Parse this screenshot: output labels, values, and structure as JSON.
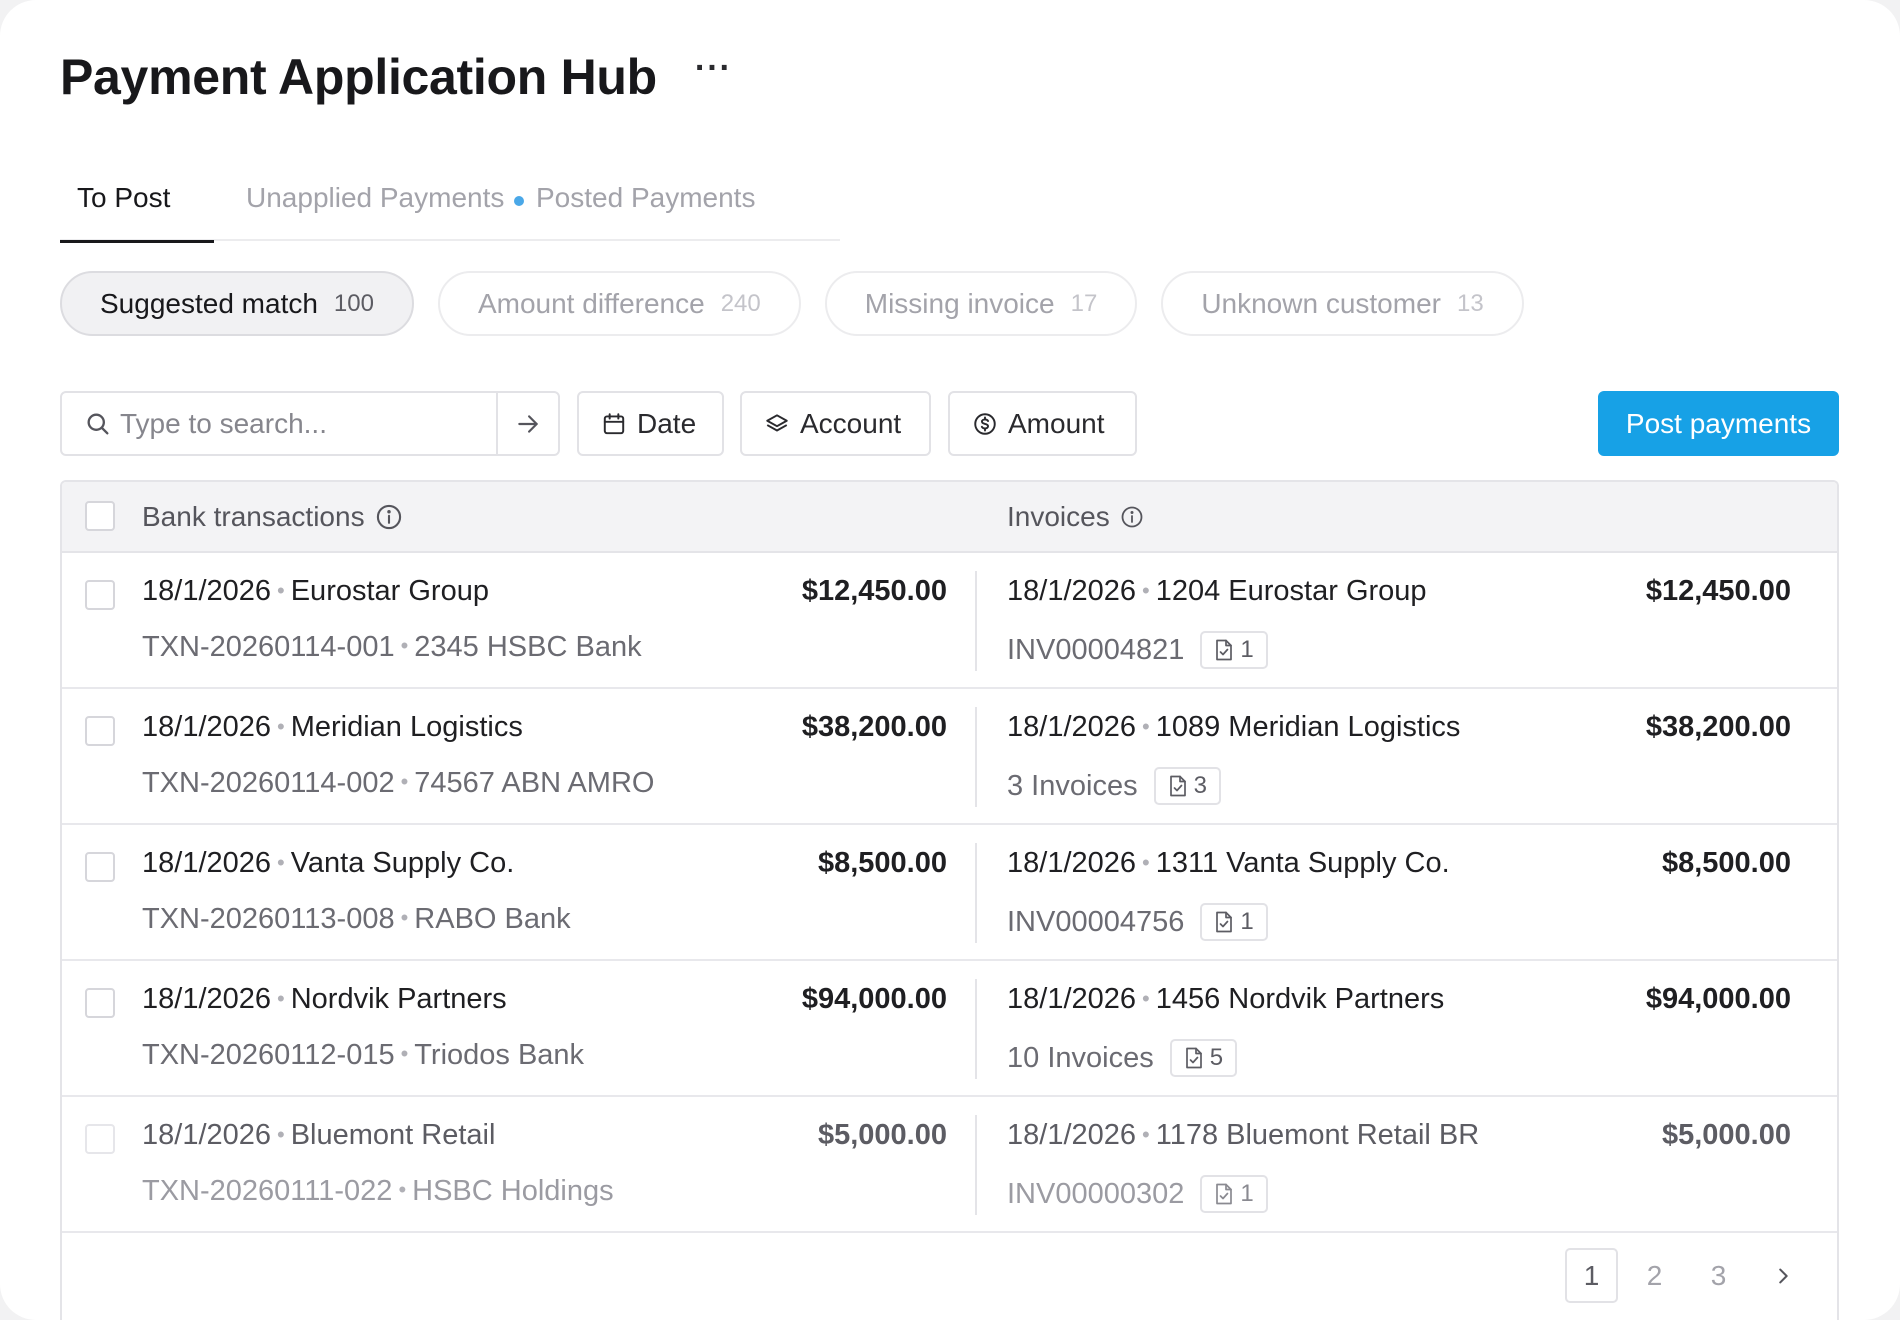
{
  "header": {
    "title": "Payment Application Hub",
    "more": "···"
  },
  "tabs": [
    {
      "label": "To Post",
      "active": true
    },
    {
      "label": "Unapplied Payments",
      "has_dot": true,
      "dot_color": "#4aa8e8"
    },
    {
      "label": "Posted Payments"
    }
  ],
  "chips": [
    {
      "label": "Suggested match",
      "count": "100",
      "active": true
    },
    {
      "label": "Amount difference",
      "count": "240"
    },
    {
      "label": "Missing invoice",
      "count": "17"
    },
    {
      "label": "Unknown customer",
      "count": "13"
    }
  ],
  "toolbar": {
    "search_placeholder": "Type to search...",
    "date_label": "Date",
    "account_label": "Account",
    "amount_label": "Amount",
    "post_label": "Post payments",
    "accent_color": "#17a1e6"
  },
  "table": {
    "col_bank": "Bank transactions",
    "col_invoices": "Invoices",
    "rows": [
      {
        "bank_date": "18/1/2026",
        "bank_name": "Eurostar Group",
        "bank_amount": "$12,450.00",
        "txn_id": "TXN-20260114-001",
        "bank_account": "2345 HSBC Bank",
        "inv_date": "18/1/2026",
        "inv_customer": "1204 Eurostar Group",
        "inv_amount": "$12,450.00",
        "inv_ref": "INV00004821",
        "doc_count": "1"
      },
      {
        "bank_date": "18/1/2026",
        "bank_name": "Meridian Logistics",
        "bank_amount": "$38,200.00",
        "txn_id": "TXN-20260114-002",
        "bank_account": "74567 ABN AMRO",
        "inv_date": "18/1/2026",
        "inv_customer": "1089 Meridian Logistics",
        "inv_amount": "$38,200.00",
        "inv_ref": "3 Invoices",
        "doc_count": "3"
      },
      {
        "bank_date": "18/1/2026",
        "bank_name": "Vanta Supply Co.",
        "bank_amount": "$8,500.00",
        "txn_id": "TXN-20260113-008",
        "bank_account": "RABO Bank",
        "inv_date": "18/1/2026",
        "inv_customer": "1311 Vanta Supply Co.",
        "inv_amount": "$8,500.00",
        "inv_ref": "INV00004756",
        "doc_count": "1"
      },
      {
        "bank_date": "18/1/2026",
        "bank_name": "Nordvik Partners",
        "bank_amount": "$94,000.00",
        "txn_id": "TXN-20260112-015",
        "bank_account": "Triodos Bank",
        "inv_date": "18/1/2026",
        "inv_customer": "1456 Nordvik Partners",
        "inv_amount": "$94,000.00",
        "inv_ref": "10 Invoices",
        "doc_count": "5"
      },
      {
        "bank_date": "18/1/2026",
        "bank_name": "Bluemont Retail",
        "bank_amount": "$5,000.00",
        "txn_id": "TXN-20260111-022",
        "bank_account": "HSBC Holdings",
        "inv_date": "18/1/2026",
        "inv_customer": "1178 Bluemont Retail BR",
        "inv_amount": "$5,000.00",
        "inv_ref": "INV00000302",
        "doc_count": "1"
      }
    ]
  },
  "pagination": {
    "pages": [
      "1",
      "2",
      "3"
    ],
    "current": "1"
  }
}
